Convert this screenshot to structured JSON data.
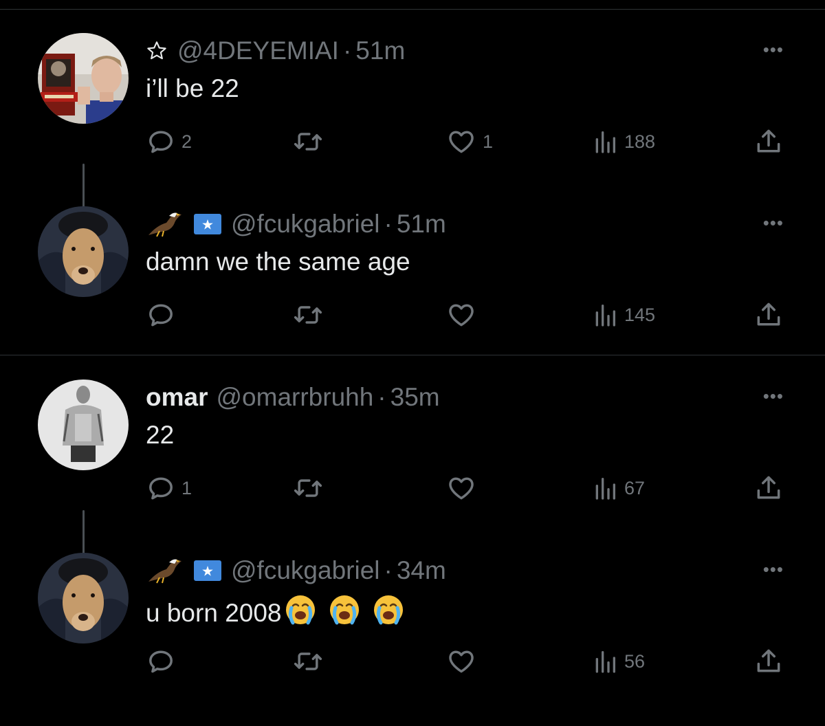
{
  "tweets": [
    {
      "name": "",
      "prefix_icon": "star-outline-icon",
      "handle": "@4DEYEMIAI",
      "time": "51m",
      "text": "i’ll be 22",
      "emojis": [],
      "replies": "2",
      "retweets": "",
      "likes": "1",
      "views": "188",
      "avatar": "man-with-book-poster-photo"
    },
    {
      "name": "",
      "prefix_icon": "eagle-emoji-and-somalia-flag",
      "handle": "@fcukgabriel",
      "time": "51m",
      "text": "damn we the same age",
      "emojis": [],
      "replies": "",
      "retweets": "",
      "likes": "",
      "views": "145",
      "avatar": "dog-with-hat-photo"
    },
    {
      "name": "omar",
      "prefix_icon": "",
      "handle": "@omarrbruhh",
      "time": "35m",
      "text": "22",
      "emojis": [],
      "replies": "1",
      "retweets": "",
      "likes": "",
      "views": "67",
      "avatar": "xray-figure-photo"
    },
    {
      "name": "",
      "prefix_icon": "eagle-emoji-and-somalia-flag",
      "handle": "@fcukgabriel",
      "time": "34m",
      "text": "u born 2008",
      "emojis": [
        "loudly-crying-face-emoji",
        "loudly-crying-face-emoji",
        "loudly-crying-face-emoji"
      ],
      "replies": "",
      "retweets": "",
      "likes": "",
      "views": "56",
      "avatar": "dog-with-hat-photo"
    }
  ],
  "separator": "·",
  "more_label": "•••",
  "colors": {
    "background": "#000000",
    "text_primary": "#e7e9ea",
    "text_secondary": "#71767b",
    "divider": "#2f3336",
    "thread_line": "#4a4f54",
    "somalia_flag": "#4189dd"
  }
}
